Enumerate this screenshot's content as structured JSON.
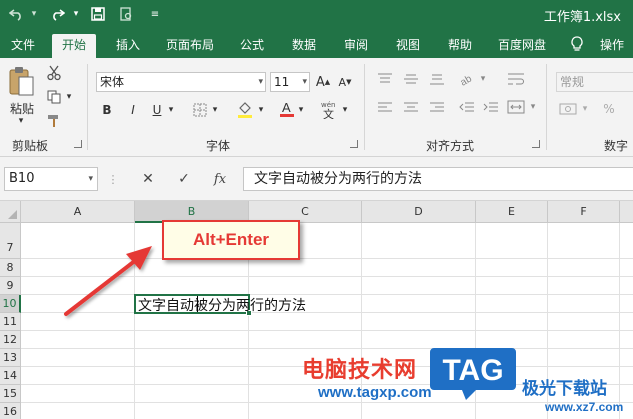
{
  "titlebar": {
    "title": "工作簿1.xlsx",
    "quick_access": [
      "undo-icon",
      "redo-icon",
      "save-icon",
      "print-preview-icon",
      "customize-icon"
    ],
    "bg_color": "#217346"
  },
  "menu": {
    "tabs": [
      {
        "label": "文件",
        "active": false
      },
      {
        "label": "开始",
        "active": true
      },
      {
        "label": "插入",
        "active": false
      },
      {
        "label": "页面布局",
        "active": false
      },
      {
        "label": "公式",
        "active": false
      },
      {
        "label": "数据",
        "active": false
      },
      {
        "label": "审阅",
        "active": false
      },
      {
        "label": "视图",
        "active": false
      },
      {
        "label": "帮助",
        "active": false
      },
      {
        "label": "百度网盘",
        "active": false
      },
      {
        "label": "操作说",
        "active": false
      }
    ]
  },
  "ribbon": {
    "clipboard": {
      "paste_label": "粘贴",
      "group_label": "剪贴板"
    },
    "font": {
      "font_name": "宋体",
      "font_size": "11",
      "group_label": "字体",
      "bold": "B",
      "italic": "I",
      "underline": "U",
      "font_color": "#e53935"
    },
    "alignment": {
      "group_label": "对齐方式"
    },
    "number": {
      "format": "常规",
      "group_label": "数字"
    }
  },
  "formula_bar": {
    "name_box": "B10",
    "cancel": "✕",
    "enter": "✓",
    "fx": "fx",
    "content": "文字自动被分为两行的方法"
  },
  "sheet": {
    "columns": [
      "A",
      "B",
      "C",
      "D",
      "E",
      "F"
    ],
    "rows": [
      "7",
      "8",
      "9",
      "10",
      "11",
      "12",
      "13",
      "14",
      "15",
      "16"
    ],
    "selected_column": "B",
    "selected_row": "10",
    "active_cell_text": "文字自动被分为两行的方法"
  },
  "annotation": {
    "text": "Alt+Enter",
    "color": "#e53935"
  },
  "watermark": {
    "cn": "电脑技术网",
    "url": "www.tagxp.com",
    "logo": "TAG",
    "cn2": "极光下载站",
    "url2": "www.xz7.com"
  }
}
